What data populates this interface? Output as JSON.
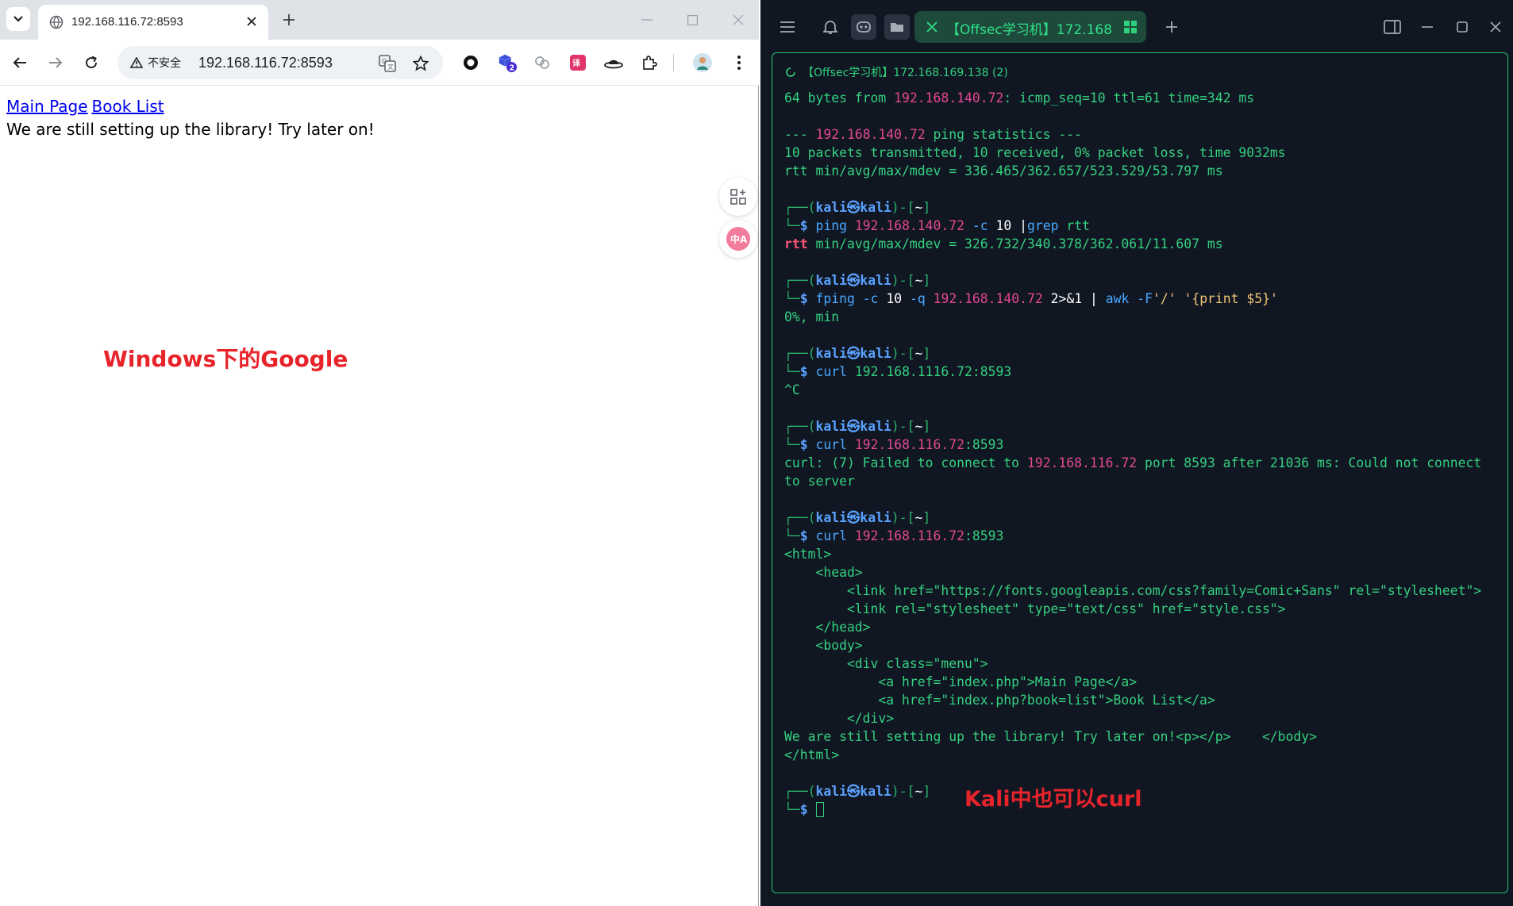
{
  "browser": {
    "tab_title": "192.168.116.72:8593",
    "insecure_label": "不安全",
    "url": "192.168.116.72:8593",
    "extension_badge": "2",
    "page": {
      "menu": [
        "Main Page",
        "Book List"
      ],
      "message": "We are still setting up the library! Try later on!"
    },
    "annotation": "Windows下的Google"
  },
  "terminal": {
    "tab_title": "【Offsec学习机】172.168.1...",
    "session_title": "【Offsec学习机】172.168.169.138 (2)",
    "annotation": "Kali中也可以curl",
    "prompt": {
      "user": "kali",
      "at": "㉿",
      "host": "kali",
      "dir": "~"
    },
    "lines": {
      "l1a": "64 bytes from ",
      "l1b": "192.168.140.72",
      "l1c": ": icmp_seq=10 ttl=61 time=342 ms",
      "l2a": "--- ",
      "l2b": "192.168.140.72",
      "l2c": " ping statistics ---",
      "l3": "10 packets transmitted, 10 received, 0% packet loss, time 9032ms",
      "l4": "rtt min/avg/max/mdev = 336.465/362.657/523.529/53.797 ms",
      "c1_cmd": "ping",
      "c1_ip": "192.168.140.72",
      "c1_flag": "-c",
      "c1_num": "10",
      "c1_pipe": "|",
      "c1_grep": "grep",
      "c1_arg": "rtt",
      "o1_rtt": "rtt",
      "o1_rest": " min/avg/max/mdev = 326.732/340.378/362.061/11.607 ms",
      "c2_cmd": "fping",
      "c2_f1": "-c",
      "c2_n1": "10",
      "c2_f2": "-q",
      "c2_ip": "192.168.140.72",
      "c2_redir": "2>&1",
      "c2_pipe": "|",
      "c2_awk": "awk",
      "c2_f3": "-F",
      "c2_s1": "'/'",
      "c2_s2": "'{print $5}'",
      "o2": "0%, min",
      "c3_cmd": "curl",
      "c3_arg": "192.168.1116.72:8593",
      "o3": "^C",
      "c4_cmd": "curl",
      "c4_ip": "192.168.116.72",
      "c4_port": ":8593",
      "o4a": "curl: (7) Failed to connect to ",
      "o4b": "192.168.116.72",
      "o4c": " port 8593 after 21036 ms: Could not connect to server",
      "c5_cmd": "curl",
      "c5_ip": "192.168.116.72",
      "c5_port": ":8593",
      "h1": "<html>",
      "h2": "    <head>",
      "h3": "        <link href=\"https://fonts.googleapis.com/css?family=Comic+Sans\" rel=\"stylesheet\">",
      "h4": "        <link rel=\"stylesheet\" type=\"text/css\" href=\"style.css\">",
      "h5": "    </head>",
      "h6": "    <body>",
      "h7": "        <div class=\"menu\">",
      "h8": "            <a href=\"index.php\">Main Page</a>",
      "h9": "            <a href=\"index.php?book=list\">Book List</a>",
      "h10": "        </div>",
      "h11": "We are still setting up the library! Try later on!<p></p>    </body>",
      "h12": "</html>"
    }
  },
  "colors": {
    "terminal_bg": "#101723",
    "terminal_green": "#35d07f",
    "ip_pink": "#e5488e",
    "cmd_blue": "#4aa8ff",
    "annotation_red": "#e8242b",
    "link_blue": "#0000ee"
  },
  "icons": [
    "tab-list-icon",
    "globe-icon",
    "close-icon",
    "plus-icon",
    "minimize-icon",
    "maximize-icon",
    "back-arrow-icon",
    "forward-arrow-icon",
    "reload-icon",
    "warning-icon",
    "translate-icon",
    "star-icon",
    "extensions-icon",
    "hamburger-icon",
    "bell-icon",
    "grid-icon",
    "split-icon"
  ]
}
